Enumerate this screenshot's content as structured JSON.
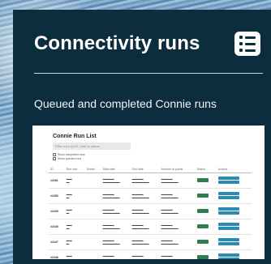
{
  "card": {
    "title": "Connectivity runs",
    "subtitle": "Queued and completed Connie runs",
    "menu_icon": "list-icon"
  },
  "preview": {
    "title": "Connie Run List",
    "search_placeholder": "Filter runs by ID, date or status",
    "checkbox_1": "Show completed runs",
    "checkbox_2": "Show queued runs",
    "columns": [
      "ID",
      "Run size",
      "Model",
      "Start date",
      "End date",
      "Number of points",
      "Status",
      "Actions"
    ],
    "rows": [
      {
        "id": "#2451"
      },
      {
        "id": "#2450"
      },
      {
        "id": "#2449"
      },
      {
        "id": "#2448"
      },
      {
        "id": "#2447"
      },
      {
        "id": "#2446"
      }
    ]
  }
}
